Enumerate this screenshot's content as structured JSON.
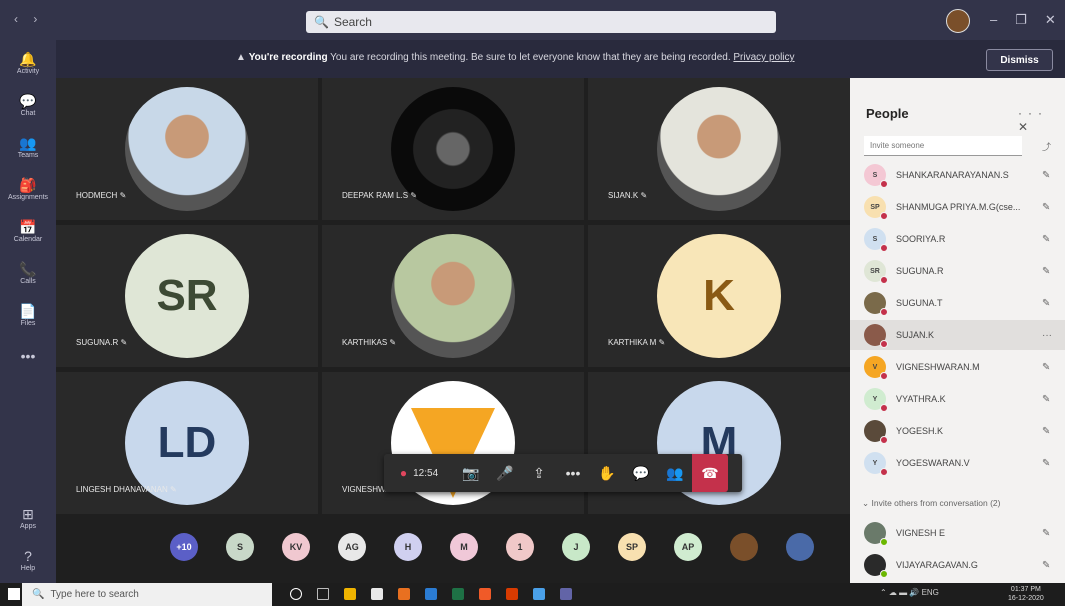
{
  "titlebar": {
    "nav": "‹ ›",
    "search_placeholder": "Search",
    "win_controls": [
      "–",
      "❐",
      "✕"
    ]
  },
  "rail": {
    "items": [
      {
        "label": "Activity",
        "icon": "bell-icon",
        "glyph": "🔔"
      },
      {
        "label": "Chat",
        "icon": "chat-icon",
        "glyph": "💬"
      },
      {
        "label": "Teams",
        "icon": "teams-icon",
        "glyph": "👥"
      },
      {
        "label": "Assignments",
        "icon": "assignments-icon",
        "glyph": "🎒"
      },
      {
        "label": "Calendar",
        "icon": "calendar-icon",
        "glyph": "📅"
      },
      {
        "label": "Calls",
        "icon": "phone-icon",
        "glyph": "📞"
      },
      {
        "label": "Files",
        "icon": "file-icon",
        "glyph": "📄"
      },
      {
        "label": "",
        "icon": "more-icon",
        "glyph": "•••"
      }
    ],
    "bottom": [
      {
        "label": "Apps",
        "icon": "apps-icon",
        "glyph": "⊞"
      },
      {
        "label": "Help",
        "icon": "help-icon",
        "glyph": "?"
      }
    ]
  },
  "banner": {
    "title": "You're recording",
    "message": "You are recording this meeting. Be sure to let everyone know that they are being recorded.",
    "policy_link": "Privacy policy",
    "dismiss_label": "Dismiss"
  },
  "tiles": [
    {
      "name": "HODMECH",
      "initials": "",
      "kind": "photo",
      "color": "#c8d8e8"
    },
    {
      "name": "DEEPAK RAM L.S",
      "initials": "",
      "kind": "photo",
      "color": "#111"
    },
    {
      "name": "SIJAN.K",
      "initials": "",
      "kind": "photo",
      "color": "#e4e4dc"
    },
    {
      "name": "SUGUNA.R",
      "initials": "SR",
      "kind": "initials",
      "color": "#dfe6d6",
      "fg": "#3d4a34"
    },
    {
      "name": "KARTHIKAS",
      "initials": "",
      "kind": "photo",
      "color": "#b8c8a0"
    },
    {
      "name": "KARTHIKA M",
      "initials": "K",
      "kind": "initials",
      "color": "#f8e6b8",
      "fg": "#8a5a14"
    },
    {
      "name": "LINGESH DHANAVANAN",
      "initials": "LD",
      "kind": "initials",
      "color": "#c8d8ec",
      "fg": "#243a5e"
    },
    {
      "name": "VIGNESHWARAN M",
      "initials": "V",
      "kind": "logo",
      "color": "#ffffff"
    },
    {
      "name": "MADHUMITHA",
      "initials": "M",
      "kind": "initials",
      "color": "#c8d8ec",
      "fg": "#243a5e"
    }
  ],
  "controls": {
    "timer": "12:54"
  },
  "overflow": {
    "count_label": "+10",
    "avatars": [
      {
        "initials": "S",
        "color": "#c8d8c8"
      },
      {
        "initials": "KV",
        "color": "#f0c8d0"
      },
      {
        "initials": "AG",
        "color": "#e8e8e8"
      },
      {
        "initials": "H",
        "color": "#d0d0f0"
      },
      {
        "initials": "M",
        "color": "#f0c8d8"
      },
      {
        "initials": "1",
        "color": "#f0c8c8"
      },
      {
        "initials": "J",
        "color": "#c8e8c8"
      },
      {
        "initials": "SP",
        "color": "#f8e0b0"
      },
      {
        "initials": "AP",
        "color": "#d0ecd0"
      },
      {
        "initials": "",
        "color": "#7a4f2a"
      },
      {
        "initials": "",
        "color": "#4a6aa8"
      }
    ]
  },
  "people": {
    "title": "People",
    "invite_placeholder": "Invite someone",
    "participants": [
      {
        "name": "SHANKARANARAYANAN.S",
        "initials": "S",
        "color": "#f4c8d4",
        "status": "#c4314b"
      },
      {
        "name": "SHANMUGA PRIYA.M.G(cse...",
        "initials": "SP",
        "color": "#f8e0b0",
        "status": "#c4314b"
      },
      {
        "name": "SOORIYA.R",
        "initials": "S",
        "color": "#d0e0f0",
        "status": "#c4314b"
      },
      {
        "name": "SUGUNA.R",
        "initials": "SR",
        "color": "#dfe6d6",
        "status": "#c4314b"
      },
      {
        "name": "SUGUNA.T",
        "initials": "",
        "color": "#7a6a4a",
        "status": "#c4314b"
      },
      {
        "name": "SUJAN.K",
        "initials": "",
        "color": "#8a5a4a",
        "status": "#c4314b"
      },
      {
        "name": "VIGNESHWARAN.M",
        "initials": "V",
        "color": "#f5a623",
        "status": "#c4314b"
      },
      {
        "name": "VYATHRA.K",
        "initials": "Y",
        "color": "#d0ecd0",
        "status": "#c4314b"
      },
      {
        "name": "YOGESH.K",
        "initials": "",
        "color": "#5a4a3a",
        "status": "#c4314b"
      },
      {
        "name": "YOGESWARAN.V",
        "initials": "Y",
        "color": "#d0e0f0",
        "status": "#c4314b"
      }
    ],
    "invite_others_label": "Invite others from conversation (2)",
    "others": [
      {
        "name": "VIGNESH E",
        "initials": "",
        "color": "#6a7a6a",
        "status": "#6bb700"
      },
      {
        "name": "VIJAYARAGAVAN.G",
        "initials": "",
        "color": "#2a2a2a",
        "status": "#6bb700"
      }
    ]
  },
  "taskbar": {
    "search_placeholder": "Type here to search",
    "tray": "ENG",
    "time": "01:37 PM",
    "date": "16-12-2020"
  }
}
